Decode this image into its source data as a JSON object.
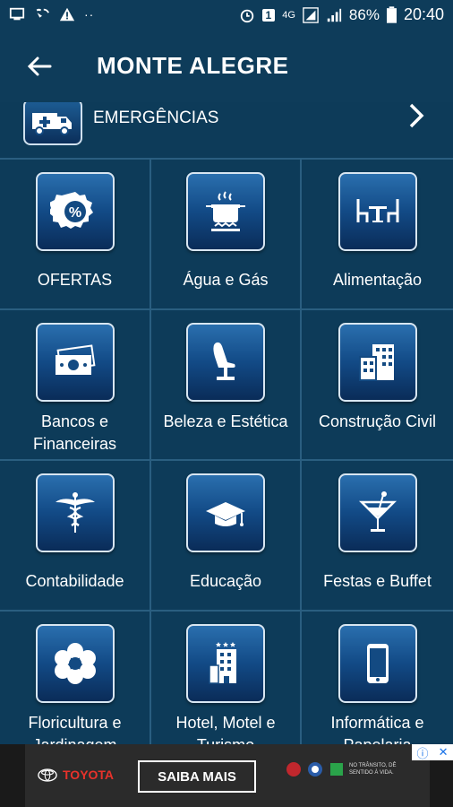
{
  "statusbar": {
    "battery": "86%",
    "time": "20:40",
    "sim": "1",
    "net": "4G"
  },
  "appbar": {
    "title": "MONTE ALEGRE"
  },
  "emergency": {
    "label": "EMERGÊNCIAS"
  },
  "categories": [
    {
      "label": "OFERTAS",
      "icon": "discount-badge-icon"
    },
    {
      "label": "Água e Gás",
      "icon": "gas-stove-pot-icon"
    },
    {
      "label": "Alimentação",
      "icon": "dining-table-icon"
    },
    {
      "label": "Bancos e Financeiras",
      "icon": "money-bills-icon"
    },
    {
      "label": "Beleza e Estética",
      "icon": "salon-chair-icon"
    },
    {
      "label": "Construção Civil",
      "icon": "buildings-icon"
    },
    {
      "label": "Contabilidade",
      "icon": "caduceus-icon"
    },
    {
      "label": "Educação",
      "icon": "graduation-cap-icon"
    },
    {
      "label": "Festas e Buffet",
      "icon": "cocktail-glass-icon"
    },
    {
      "label": "Floricultura e Jardinagem",
      "icon": "flower-icon"
    },
    {
      "label": "Hotel, Motel e Turismo",
      "icon": "hotel-building-icon"
    },
    {
      "label": "Informática e Papelaria",
      "icon": "smartphone-icon"
    }
  ],
  "ad": {
    "brand": "TOYOTA",
    "cta": "SAIBA MAIS",
    "tagline": "NO TRÂNSITO, DÊ SENTIDO À VIDA."
  }
}
